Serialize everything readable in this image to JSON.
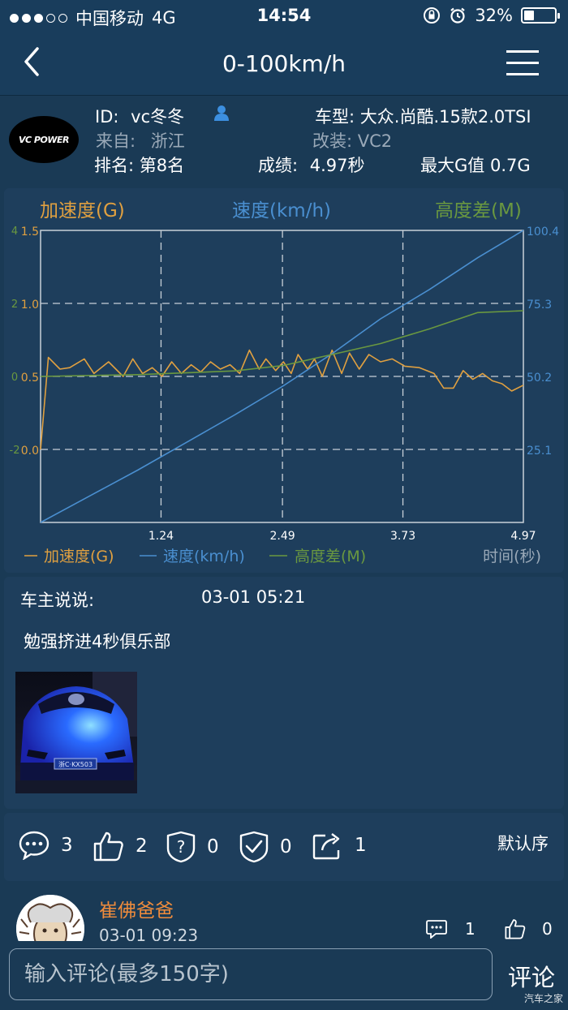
{
  "status_bar": {
    "carrier": "中国移动",
    "network": "4G",
    "time": "14:54",
    "battery": "32%",
    "battery_level": 0.32
  },
  "nav": {
    "title": "0-100km/h",
    "back_icon": "chevron-left-icon",
    "menu_icon": "hamburger-menu-icon"
  },
  "profile": {
    "id_label": "ID:",
    "id_value": "vc冬冬",
    "logo_text": "VC POWER",
    "from_label": "来自:",
    "from_value": "浙江",
    "rank_label": "排名:",
    "rank_value": "第8名",
    "car_label": "车型:",
    "car_value": "大众.尚酷.15款2.0TSI",
    "mod_label": "改装:",
    "mod_value": "VC2",
    "score_label": "成绩:",
    "score_value": "4.97秒",
    "maxg_label": "最大G值",
    "maxg_value": "0.7G"
  },
  "chart_legend_top": {
    "accel": "加速度(G)",
    "speed": "速度(km/h)",
    "height": "高度差(M)"
  },
  "chart_legend_bottom": {
    "accel": "加速度(G)",
    "speed": "速度(km/h)",
    "height": "高度差(M)",
    "time": "时间(秒)"
  },
  "colors": {
    "accel": "#e0a040",
    "speed": "#4a8fd0",
    "height": "#6a9840",
    "bg": "#1a3a55",
    "card": "#1e3e5c",
    "username": "#f08c3c"
  },
  "chart_data": {
    "type": "line",
    "x_ticks": [
      "1.24",
      "2.49",
      "3.73",
      "4.97"
    ],
    "xlim": [
      0,
      4.97
    ],
    "height_ticks": [
      "4",
      "2",
      "0",
      "-2"
    ],
    "accel_ticks": [
      "1.5",
      "1.0",
      "0.5",
      "0.0"
    ],
    "speed_ticks": [
      "100.4",
      "75.3",
      "50.2",
      "25.1"
    ],
    "grid": true,
    "series": [
      {
        "name": "加速度(G)",
        "axis": "accel",
        "ylim": [
          -0.5,
          1.5
        ],
        "points": [
          [
            0,
            0.0
          ],
          [
            0.08,
            0.63
          ],
          [
            0.2,
            0.55
          ],
          [
            0.3,
            0.56
          ],
          [
            0.45,
            0.62
          ],
          [
            0.55,
            0.52
          ],
          [
            0.7,
            0.6
          ],
          [
            0.85,
            0.5
          ],
          [
            0.95,
            0.62
          ],
          [
            1.05,
            0.52
          ],
          [
            1.15,
            0.56
          ],
          [
            1.25,
            0.5
          ],
          [
            1.35,
            0.6
          ],
          [
            1.45,
            0.52
          ],
          [
            1.55,
            0.58
          ],
          [
            1.65,
            0.53
          ],
          [
            1.75,
            0.6
          ],
          [
            1.85,
            0.55
          ],
          [
            1.95,
            0.58
          ],
          [
            2.05,
            0.52
          ],
          [
            2.15,
            0.68
          ],
          [
            2.25,
            0.55
          ],
          [
            2.32,
            0.62
          ],
          [
            2.42,
            0.54
          ],
          [
            2.5,
            0.6
          ],
          [
            2.58,
            0.52
          ],
          [
            2.65,
            0.65
          ],
          [
            2.75,
            0.55
          ],
          [
            2.82,
            0.62
          ],
          [
            2.9,
            0.5
          ],
          [
            3.0,
            0.68
          ],
          [
            3.1,
            0.52
          ],
          [
            3.18,
            0.66
          ],
          [
            3.28,
            0.55
          ],
          [
            3.38,
            0.65
          ],
          [
            3.5,
            0.6
          ],
          [
            3.62,
            0.62
          ],
          [
            3.75,
            0.57
          ],
          [
            3.9,
            0.56
          ],
          [
            4.05,
            0.52
          ],
          [
            4.15,
            0.42
          ],
          [
            4.25,
            0.42
          ],
          [
            4.35,
            0.54
          ],
          [
            4.45,
            0.48
          ],
          [
            4.55,
            0.52
          ],
          [
            4.65,
            0.47
          ],
          [
            4.75,
            0.45
          ],
          [
            4.85,
            0.4
          ],
          [
            4.97,
            0.44
          ]
        ]
      },
      {
        "name": "速度(km/h)",
        "axis": "speed",
        "ylim": [
          0,
          100.4
        ],
        "points": [
          [
            0,
            0
          ],
          [
            0.5,
            9
          ],
          [
            1.0,
            18
          ],
          [
            1.5,
            27.5
          ],
          [
            2.0,
            37
          ],
          [
            2.5,
            47
          ],
          [
            3.0,
            58
          ],
          [
            3.5,
            70
          ],
          [
            4.0,
            80
          ],
          [
            4.5,
            91
          ],
          [
            4.97,
            100.4
          ]
        ]
      },
      {
        "name": "高度差(M)",
        "axis": "height",
        "ylim": [
          -4,
          4
        ],
        "points": [
          [
            0,
            0
          ],
          [
            1.0,
            0.05
          ],
          [
            2.0,
            0.15
          ],
          [
            2.5,
            0.3
          ],
          [
            3.0,
            0.6
          ],
          [
            3.5,
            0.9
          ],
          [
            4.0,
            1.3
          ],
          [
            4.5,
            1.75
          ],
          [
            4.97,
            1.8
          ]
        ]
      }
    ]
  },
  "post": {
    "owner_label": "车主说说:",
    "date": "03-01 05:21",
    "text": "勉强挤进4秒俱乐部",
    "plate": "浙C·KX503"
  },
  "actions": {
    "comments": "3",
    "likes": "2",
    "doubts": "0",
    "verified": "0",
    "shares": "1",
    "sort": "默认序"
  },
  "comment": {
    "username": "崔佛爸爸",
    "time": "03-01 09:23",
    "replies": "1",
    "likes": "0"
  },
  "input": {
    "placeholder": "输入评论(最多150字)",
    "send": "评论"
  },
  "watermark": "汽车之家"
}
